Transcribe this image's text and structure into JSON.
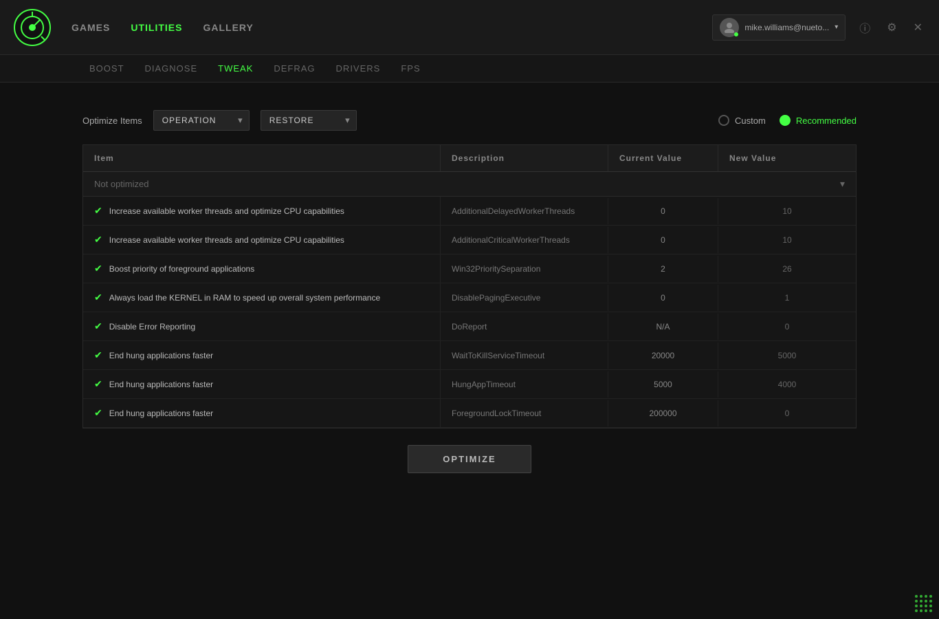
{
  "app": {
    "logo_alt": "Razer Cortex Logo"
  },
  "nav_main": {
    "items": [
      {
        "label": "GAMES",
        "active": false
      },
      {
        "label": "UTILITIES",
        "active": true
      },
      {
        "label": "GALLERY",
        "active": false
      }
    ]
  },
  "nav_sub": {
    "items": [
      {
        "label": "BOOST",
        "active": false
      },
      {
        "label": "DIAGNOSE",
        "active": false
      },
      {
        "label": "TWEAK",
        "active": true
      },
      {
        "label": "DEFRAG",
        "active": false
      },
      {
        "label": "DRIVERS",
        "active": false
      },
      {
        "label": "FPS",
        "active": false
      }
    ]
  },
  "user": {
    "name": "mike.williams@nueto...",
    "status": "online"
  },
  "toolbar": {
    "optimize_items_label": "Optimize Items",
    "operation_label": "OPERATION",
    "restore_label": "RESTORE",
    "custom_label": "Custom",
    "recommended_label": "Recommended"
  },
  "table": {
    "headers": [
      "Item",
      "Description",
      "Current Value",
      "New Value"
    ],
    "not_optimized_label": "Not optimized",
    "rows": [
      {
        "item": "Increase available worker threads and optimize CPU capabilities",
        "description": "AdditionalDelayedWorkerThreads",
        "current": "0",
        "new_val": "10"
      },
      {
        "item": "Increase available worker threads and optimize CPU capabilities",
        "description": "AdditionalCriticalWorkerThreads",
        "current": "0",
        "new_val": "10"
      },
      {
        "item": "Boost priority of foreground applications",
        "description": "Win32PrioritySeparation",
        "current": "2",
        "new_val": "26"
      },
      {
        "item": "Always load the KERNEL in RAM to speed up overall system performance",
        "description": "DisablePagingExecutive",
        "current": "0",
        "new_val": "1"
      },
      {
        "item": "Disable Error Reporting",
        "description": "DoReport",
        "current": "N/A",
        "new_val": "0"
      },
      {
        "item": "End hung applications faster",
        "description": "WaitToKillServiceTimeout",
        "current": "20000",
        "new_val": "5000"
      },
      {
        "item": "End hung applications faster",
        "description": "HungAppTimeout",
        "current": "5000",
        "new_val": "4000"
      },
      {
        "item": "End hung applications faster",
        "description": "ForegroundLockTimeout",
        "current": "200000",
        "new_val": "0"
      }
    ]
  },
  "buttons": {
    "optimize": "OPTIMIZE"
  },
  "colors": {
    "accent": "#44ff44",
    "bg_dark": "#111111",
    "bg_medium": "#1a1a1a"
  }
}
